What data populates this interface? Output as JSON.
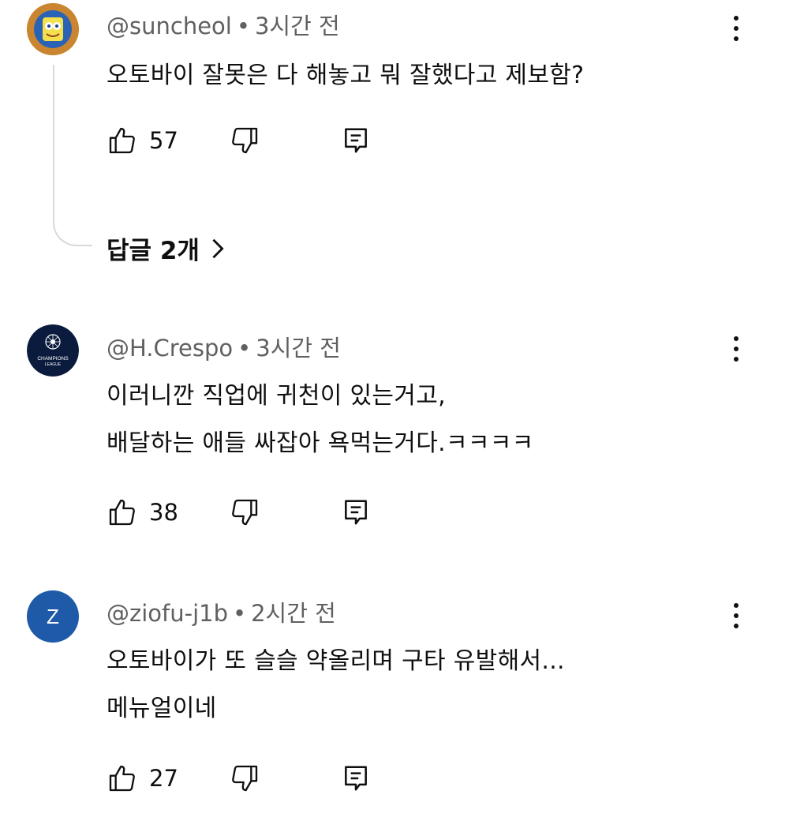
{
  "comments": [
    {
      "author": "@suncheol",
      "time": "3시간 전",
      "lines": [
        "오토바이 잘못은 다 해놓고 뭐 잘했다고 제보함?"
      ],
      "likes": "57",
      "replies_label": "답글 2개",
      "avatar": "spongebob-avatar"
    },
    {
      "author": "@H.Crespo",
      "time": "3시간 전",
      "lines": [
        "이러니깐 직업에 귀천이 있는거고,",
        "배달하는 애들 싸잡아 욕먹는거다.ㅋㅋㅋㅋ"
      ],
      "likes": "38",
      "avatar": "champions-league-avatar",
      "avatar_text": [
        "CHAMPIONS",
        "LEAGUE"
      ]
    },
    {
      "author": "@ziofu-j1b",
      "time": "2시간 전",
      "lines": [
        "오토바이가 또 슬슬 약올리며 구타 유발해서...",
        "메뉴얼이네"
      ],
      "likes": "27",
      "avatar": "letter-avatar",
      "avatar_letter": "Z",
      "avatar_color": "#1e5aa8"
    }
  ],
  "separator": "•"
}
